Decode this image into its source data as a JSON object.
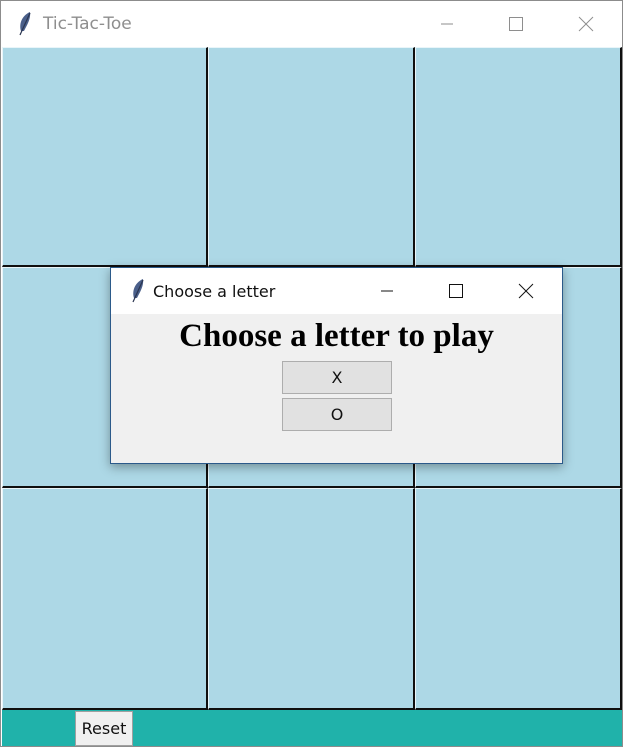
{
  "window": {
    "title": "Tic-Tac-Toe",
    "icon": "feather-icon",
    "controls": [
      "minimize-icon",
      "maximize-icon",
      "close-icon"
    ]
  },
  "board": {
    "rows": 3,
    "cols": 3,
    "cells": [
      "",
      "",
      "",
      "",
      "",
      "",
      "",
      "",
      ""
    ],
    "cell_color": "#add8e6"
  },
  "bottom_bar": {
    "color": "#20b2aa",
    "reset_label": "Reset"
  },
  "dialog": {
    "title": "Choose a letter",
    "icon": "feather-icon",
    "heading": "Choose a letter to play",
    "options": [
      "X",
      "O"
    ]
  }
}
